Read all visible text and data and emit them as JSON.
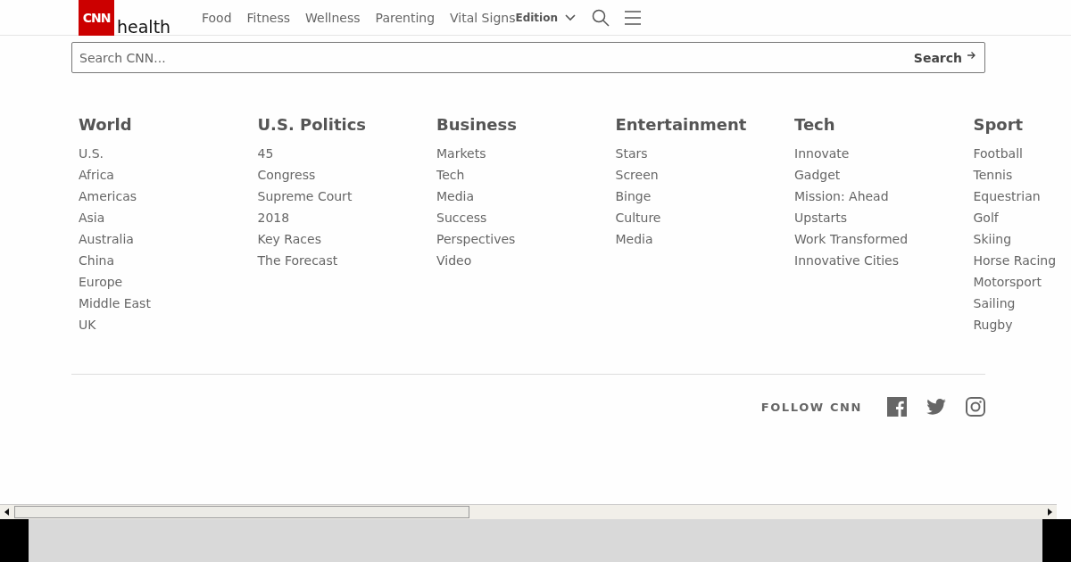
{
  "header": {
    "logo": "CNN",
    "section": "health",
    "nav": [
      "Food",
      "Fitness",
      "Wellness",
      "Parenting",
      "Vital Signs"
    ],
    "edition": "Edition"
  },
  "search": {
    "placeholder": "Search CNN...",
    "button": "Search"
  },
  "columns": [
    {
      "title": "World",
      "links": [
        "U.S.",
        "Africa",
        "Americas",
        "Asia",
        "Australia",
        "China",
        "Europe",
        "Middle East",
        "UK"
      ]
    },
    {
      "title": "U.S. Politics",
      "links": [
        "45",
        "Congress",
        "Supreme Court",
        "2018",
        "Key Races",
        "The Forecast"
      ]
    },
    {
      "title": "Business",
      "links": [
        "Markets",
        "Tech",
        "Media",
        "Success",
        "Perspectives",
        "Video"
      ]
    },
    {
      "title": "Entertainment",
      "links": [
        "Stars",
        "Screen",
        "Binge",
        "Culture",
        "Media"
      ]
    },
    {
      "title": "Tech",
      "links": [
        "Innovate",
        "Gadget",
        "Mission: Ahead",
        "Upstarts",
        "Work Transformed",
        "Innovative Cities"
      ]
    },
    {
      "title": "Sport",
      "links": [
        "Football",
        "Tennis",
        "Equestrian",
        "Golf",
        "Skiing",
        "Horse Racing",
        "Motorsport",
        "Sailing",
        "Rugby"
      ]
    }
  ],
  "follow": {
    "label": "FOLLOW CNN"
  }
}
